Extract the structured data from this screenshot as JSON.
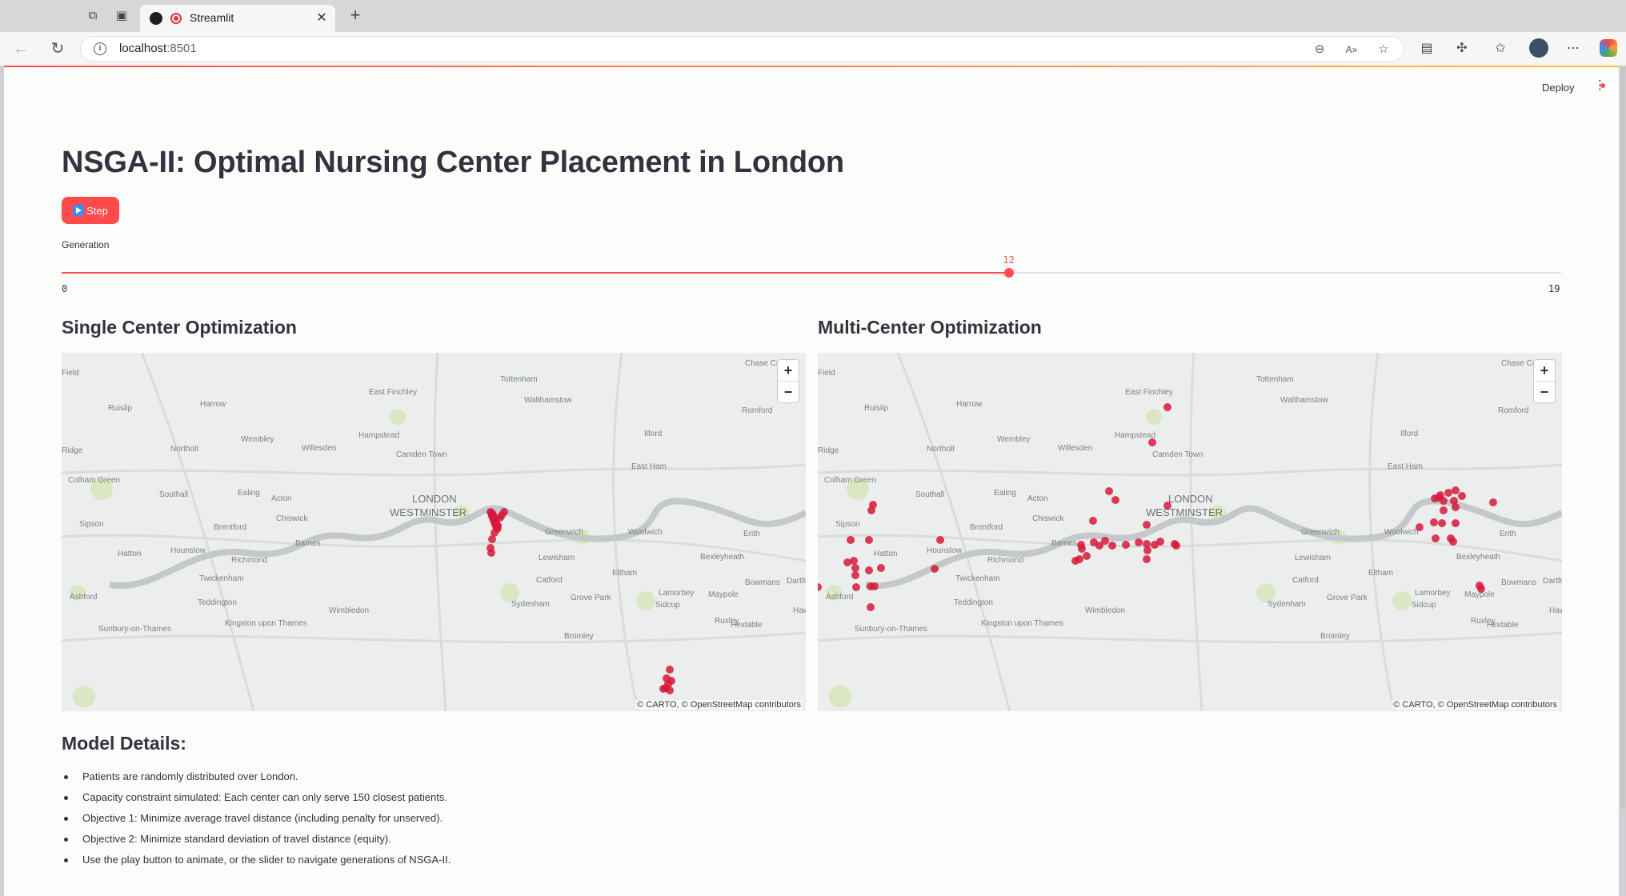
{
  "browser": {
    "tab_title": "Streamlit",
    "url_host": "localhost",
    "url_port": ":8501"
  },
  "header": {
    "deploy_label": "Deploy"
  },
  "app": {
    "title": "NSGA-II: Optimal Nursing Center Placement in London",
    "step_label": "Step",
    "slider": {
      "label": "Generation",
      "min": 0,
      "max": 19,
      "value": 12,
      "min_text": "0",
      "max_text": "19",
      "value_text": "12"
    }
  },
  "maps": {
    "single": {
      "title": "Single Center Optimization",
      "attribution": "© CARTO, © OpenStreetMap contributors",
      "zoom_in": "+",
      "zoom_out": "−",
      "places": [
        "Tottenham",
        "East Finchley",
        "Walthamstow",
        "Ruislip",
        "Harrow",
        "Romford",
        "Hampstead",
        "Ilford",
        "Wembley",
        "Northolt",
        "Willesden",
        "Camden Town",
        "East Ham",
        "Southall",
        "Ealing",
        "Acton",
        "LONDON",
        "WESTMINSTER",
        "Chiswick",
        "Brentford",
        "Greenwich",
        "Woolwich",
        "Erith",
        "Barnes",
        "Hounslow",
        "Richmond",
        "Lewisham",
        "Bexleyheath",
        "Twickenham",
        "Catford",
        "Eltham",
        "Ashford",
        "Teddington",
        "Grove Park",
        "Sidcup",
        "Wimbledon",
        "Sydenham",
        "Sunbury-on-Thames",
        "Kingston upon Thames",
        "Bromley",
        "Chase Cross",
        "Colham Green",
        "Sipson",
        "Hatton",
        "Lamorbey",
        "Maypole",
        "Bowmans",
        "Dartford",
        "Ruxley",
        "Hextable",
        "Field",
        "Ridge",
        "Hawley"
      ]
    },
    "multi": {
      "title": "Multi-Center Optimization",
      "attribution": "© CARTO, © OpenStreetMap contributors",
      "zoom_in": "+",
      "zoom_out": "−"
    },
    "point_color": "#d7193b"
  },
  "details": {
    "title": "Model Details:",
    "items": [
      "Patients are randomly distributed over London.",
      "Capacity constraint simulated: Each center can only serve 150 closest patients.",
      "Objective 1: Minimize average travel distance (including penalty for unserved).",
      "Objective 2: Minimize standard deviation of travel distance (equity).",
      "Use the play button to animate, or the slider to navigate generations of NSGA-II."
    ]
  }
}
